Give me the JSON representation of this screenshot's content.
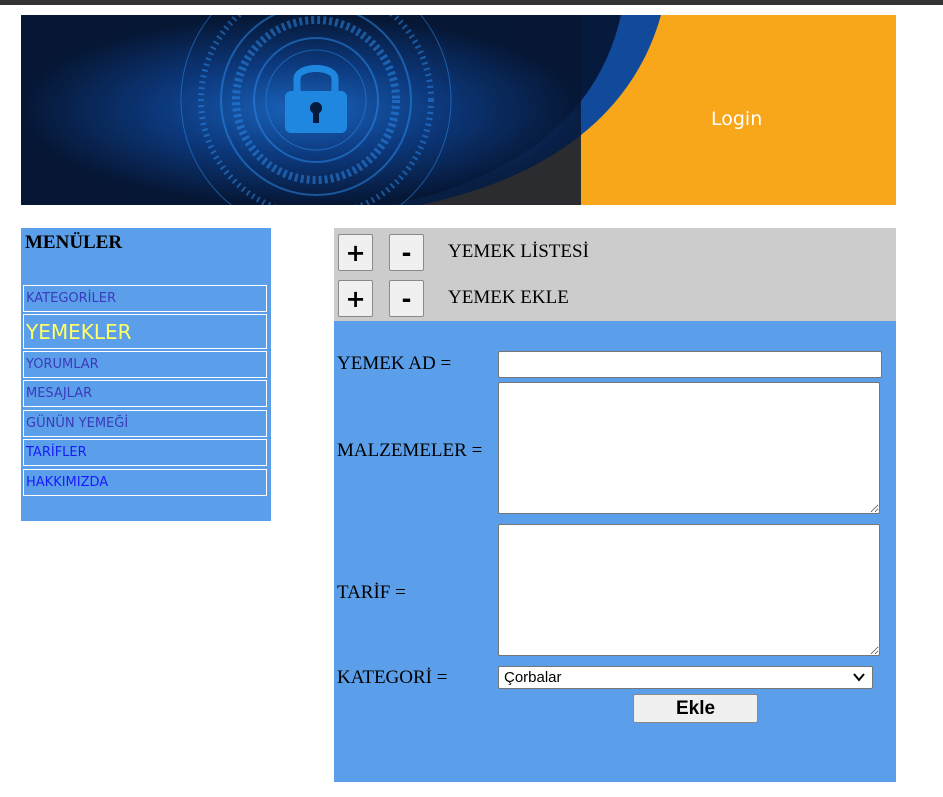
{
  "banner": {
    "login_label": "Login"
  },
  "sidebar": {
    "title": "MENÜLER",
    "items": [
      {
        "label": "KATEGORİLER"
      },
      {
        "label": "YEMEKLER"
      },
      {
        "label": "YORUMLAR"
      },
      {
        "label": "MESAJLAR"
      },
      {
        "label": "GÜNÜN YEMEĞİ"
      },
      {
        "label": "TARİFLER"
      },
      {
        "label": "HAKKIMIZDA"
      }
    ]
  },
  "panel": {
    "rows": [
      {
        "plus": "+",
        "minus": "-",
        "label": "YEMEK LİSTESİ"
      },
      {
        "plus": "+",
        "minus": "-",
        "label": "YEMEK EKLE"
      }
    ]
  },
  "form": {
    "name_label": "YEMEK AD =",
    "name_value": "",
    "ingredients_label": "MALZEMELER =",
    "ingredients_value": "",
    "recipe_label": "TARİF =",
    "recipe_value": "",
    "category_label": "KATEGORİ =",
    "category_selected": "Çorbalar",
    "submit_label": "Ekle"
  },
  "colors": {
    "panel_blue": "#5b9ee9",
    "header_gray": "#cccccc",
    "banner_orange": "#f8a61a",
    "banner_navy": "#0b1e44",
    "active_menu": "#ffff66"
  }
}
